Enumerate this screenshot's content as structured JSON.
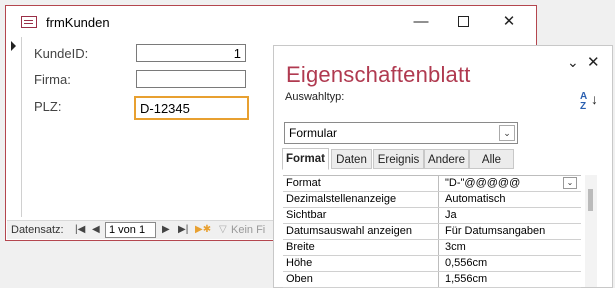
{
  "form_window": {
    "title": "frmKunden",
    "fields": [
      {
        "label": "KundeID:",
        "value": "1"
      },
      {
        "label": "Firma:",
        "value": ""
      },
      {
        "label": "PLZ:",
        "value": "D-12345"
      }
    ]
  },
  "navigation": {
    "label": "Datensatz:",
    "record": "1 von 1",
    "filter_label": "Kein Fi"
  },
  "property_sheet": {
    "title": "Eigenschaftenblatt",
    "selection_type_label": "Auswahltyp:",
    "selected_object": "Formular",
    "tabs": [
      "Format",
      "Daten",
      "Ereignis",
      "Andere",
      "Alle"
    ],
    "active_tab": "Format",
    "properties": [
      {
        "name": "Format",
        "value": "\"D-\"@@@@@"
      },
      {
        "name": "Dezimalstellenanzeige",
        "value": "Automatisch"
      },
      {
        "name": "Sichtbar",
        "value": "Ja"
      },
      {
        "name": "Datumsauswahl anzeigen",
        "value": "Für Datumsangaben"
      },
      {
        "name": "Breite",
        "value": "3cm"
      },
      {
        "name": "Höhe",
        "value": "0,556cm"
      },
      {
        "name": "Oben",
        "value": "1,556cm"
      }
    ]
  },
  "colors": {
    "accent": "#b03a50",
    "focus_border": "#e8a030"
  }
}
